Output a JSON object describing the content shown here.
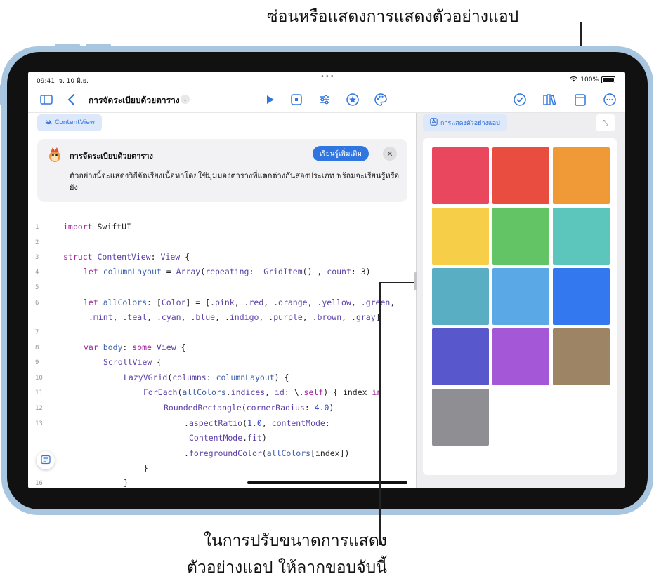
{
  "callouts": {
    "top": "ซ่อนหรือแสดงการแสดงตัวอย่างแอป",
    "bottom_line1": "ในการปรับขนาดการแสดง",
    "bottom_line2": "ตัวอย่างแอป ให้ลากขอบจับนี้"
  },
  "status_bar": {
    "time": "09:41",
    "date": "จ. 10 มิ.ย.",
    "dots": "•••",
    "battery": "100%"
  },
  "toolbar": {
    "title": "การจัดระเบียบด้วยตาราง",
    "title_chevron": "⌄"
  },
  "editor": {
    "tab_label": "ContentView",
    "info_title": "การจัดระเบียบด้วยตาราง",
    "learn_more": "เรียนรู้เพิ่มเติม",
    "close": "✕",
    "info_body": "ตัวอย่างนี้จะแสดงวิธีจัดเรียงเนื้อหาโดยใช้มุมมองตารางที่แตกต่างกันสองประเภท พร้อมจะเรียนรู้หรือยัง",
    "line_numbers": [
      "1",
      "2",
      "3",
      "4",
      "5",
      "6",
      "",
      "7",
      "8",
      "9",
      "10",
      "11",
      "12",
      "13",
      "",
      "",
      "",
      "",
      "16"
    ]
  },
  "preview": {
    "tab_label": "การแสดงตัวอย่างแอป",
    "expand": "⤡",
    "swatches": [
      {
        "name": "pink",
        "color": "#e8475d"
      },
      {
        "name": "red",
        "color": "#e94d3f"
      },
      {
        "name": "orange",
        "color": "#ef9a36"
      },
      {
        "name": "yellow",
        "color": "#f6ce47"
      },
      {
        "name": "green",
        "color": "#63c466"
      },
      {
        "name": "mint",
        "color": "#5cc5bc"
      },
      {
        "name": "teal",
        "color": "#5aaec4"
      },
      {
        "name": "cyan",
        "color": "#5aa9e6"
      },
      {
        "name": "blue",
        "color": "#3478f0"
      },
      {
        "name": "indigo",
        "color": "#5957cc"
      },
      {
        "name": "purple",
        "color": "#a458d8"
      },
      {
        "name": "brown",
        "color": "#9d8465"
      },
      {
        "name": "gray",
        "color": "#8e8e93"
      }
    ]
  },
  "colors": {
    "accent": "#2f76e0",
    "device_frame": "#a9c6e0"
  }
}
